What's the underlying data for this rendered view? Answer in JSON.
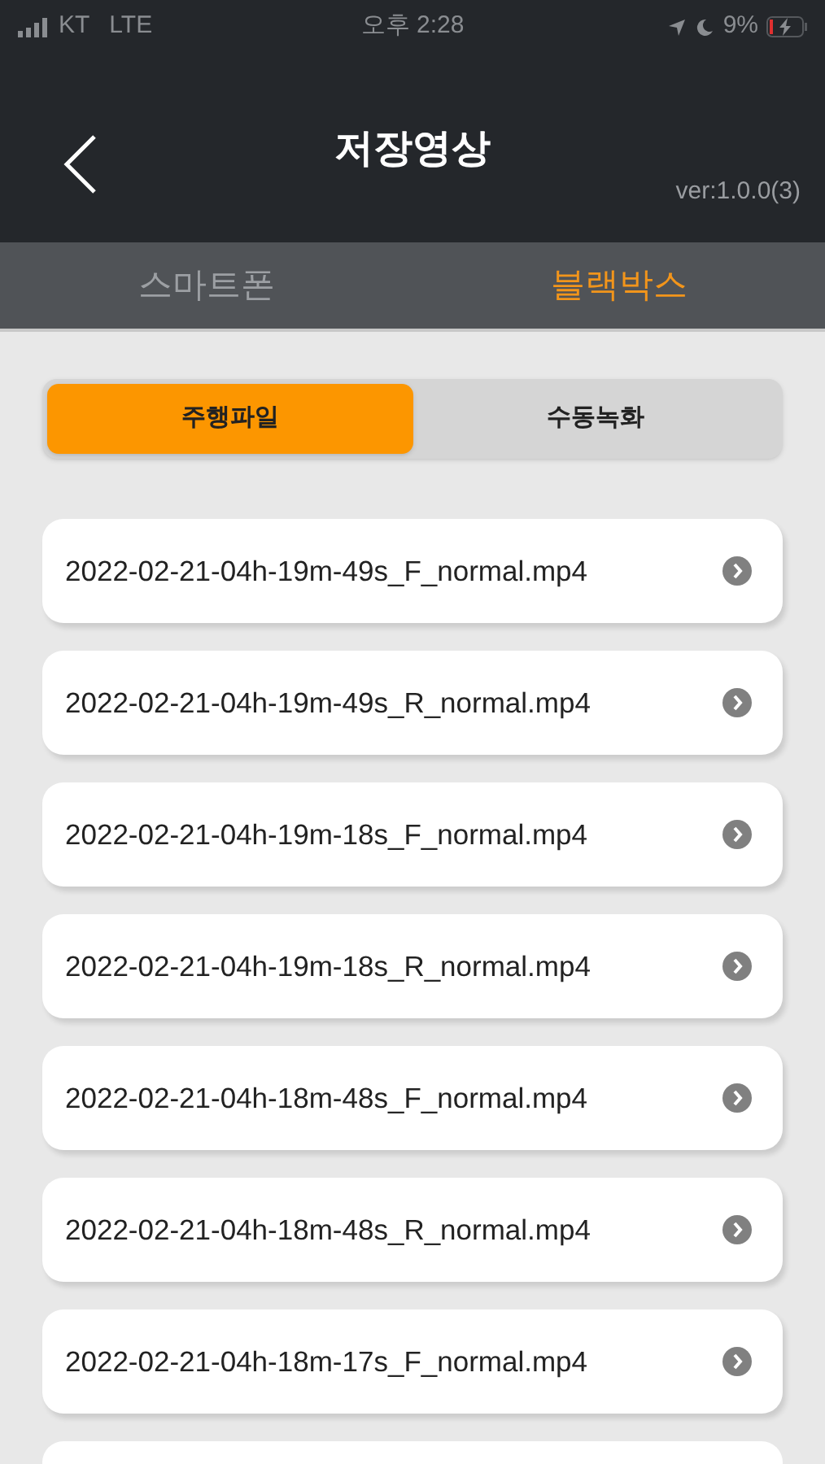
{
  "status_bar": {
    "carrier": "KT",
    "network": "LTE",
    "time": "오후 2:28",
    "battery": "9%"
  },
  "header": {
    "title": "저장영상",
    "version": "ver:1.0.0(3)"
  },
  "tabs": [
    {
      "label": "스마트폰",
      "selected": false
    },
    {
      "label": "블랙박스",
      "selected": true
    }
  ],
  "segments": [
    {
      "label": "주행파일",
      "selected": true
    },
    {
      "label": "수동녹화",
      "selected": false
    }
  ],
  "files": [
    {
      "name": "2022-02-21-04h-19m-49s_F_normal.mp4"
    },
    {
      "name": "2022-02-21-04h-19m-49s_R_normal.mp4"
    },
    {
      "name": "2022-02-21-04h-19m-18s_F_normal.mp4"
    },
    {
      "name": "2022-02-21-04h-19m-18s_R_normal.mp4"
    },
    {
      "name": "2022-02-21-04h-18m-48s_F_normal.mp4"
    },
    {
      "name": "2022-02-21-04h-18m-48s_R_normal.mp4"
    },
    {
      "name": "2022-02-21-04h-18m-17s_F_normal.mp4"
    }
  ]
}
